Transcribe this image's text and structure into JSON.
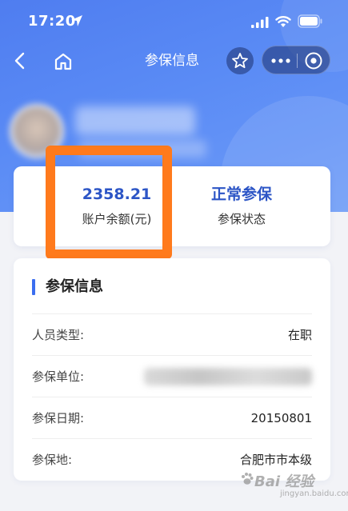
{
  "status_bar": {
    "time": "17:20"
  },
  "nav": {
    "title": "参保信息"
  },
  "stats": {
    "balance_value": "2358.21",
    "balance_label": "账户余额(元)",
    "status_value": "正常参保",
    "status_label": "参保状态"
  },
  "info": {
    "section_title": "参保信息",
    "rows": [
      {
        "label": "人员类型:",
        "value": "在职"
      },
      {
        "label": "参保单位:",
        "value": ""
      },
      {
        "label": "参保日期:",
        "value": "20150801"
      },
      {
        "label": "参保地:",
        "value": "合肥市市本级"
      }
    ]
  },
  "watermark": {
    "main": "Bai 经验",
    "sub": "jingyan.baidu.com"
  },
  "colors": {
    "header_blue": "#5a8bf5",
    "value_blue": "#2c55c6",
    "section_accent": "#3b6ef0",
    "highlight_orange": "#ff7a1c"
  },
  "icons": [
    "location-arrow-icon",
    "signal-icon",
    "wifi-icon",
    "battery-icon",
    "back-icon",
    "home-icon",
    "star-icon",
    "more-dots-icon",
    "target-icon"
  ]
}
